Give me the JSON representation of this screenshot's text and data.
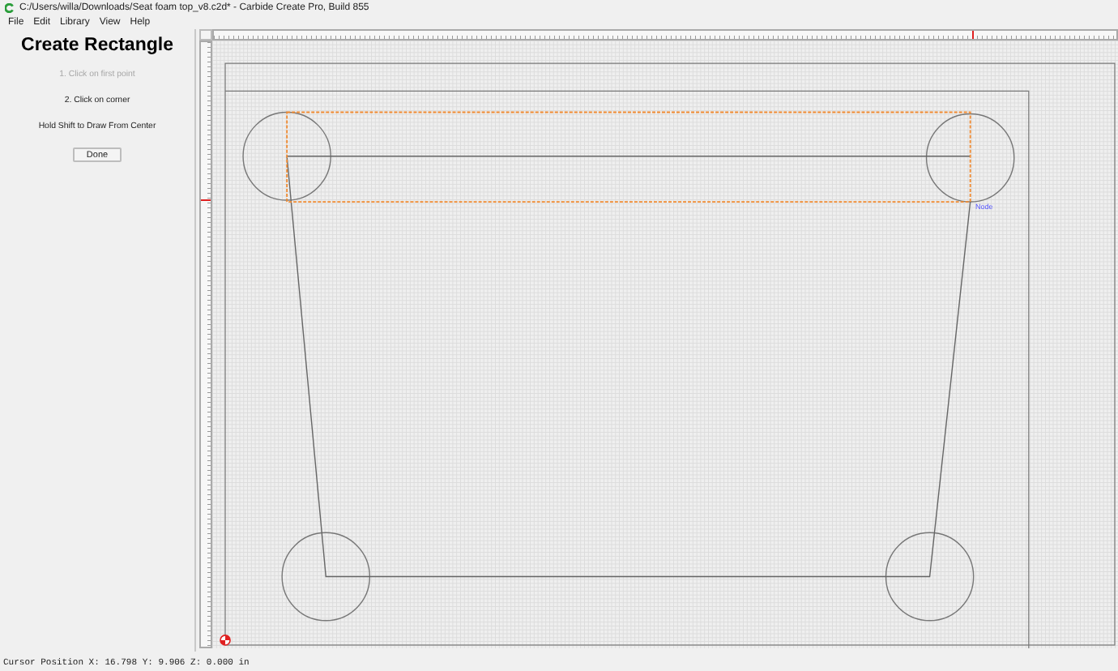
{
  "window": {
    "title": "C:/Users/willa/Downloads/Seat foam top_v8.c2d* - Carbide Create Pro, Build 855"
  },
  "menu": [
    {
      "label": "File"
    },
    {
      "label": "Edit"
    },
    {
      "label": "Library"
    },
    {
      "label": "View"
    },
    {
      "label": "Help"
    }
  ],
  "panel": {
    "title": "Create Rectangle",
    "steps": [
      {
        "text": "1. Click on first point",
        "disabled": true
      },
      {
        "text": "2. Click on corner",
        "disabled": false
      }
    ],
    "hint": "Hold Shift to Draw From Center",
    "button": "Done"
  },
  "canvas": {
    "snap_label": "Node"
  },
  "status_bar": "Cursor Position X: 16.798 Y: 9.906 Z: 0.000 in"
}
